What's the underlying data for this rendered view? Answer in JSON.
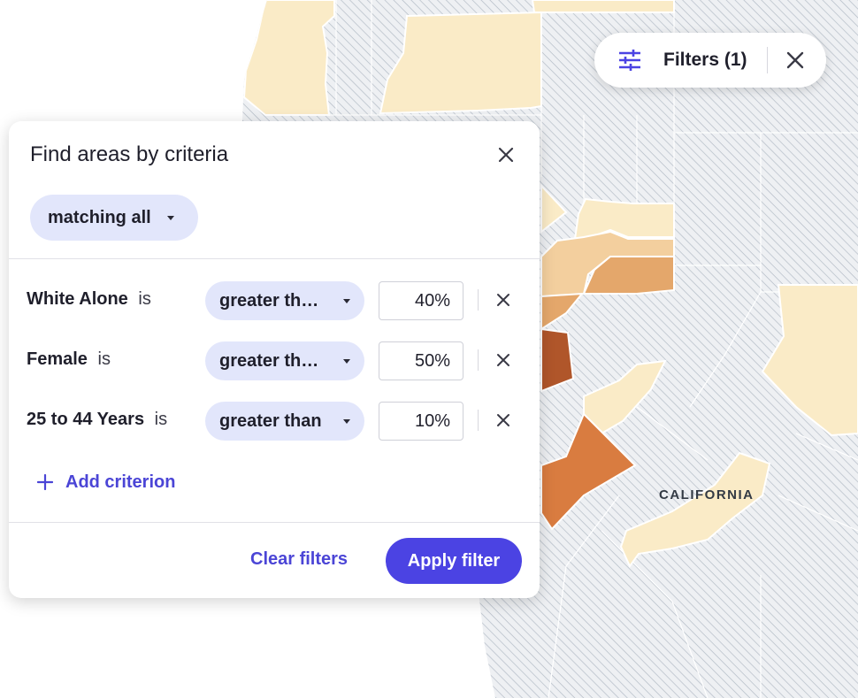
{
  "map": {
    "region_label": "CALIFORNIA",
    "colors": {
      "no_data_hatch": "#b4bcc6",
      "no_data_bg": "#eef0f3",
      "tier_1": "#faebc7",
      "tier_2": "#f3cf9e",
      "tier_3": "#e4a76b",
      "tier_4": "#d97c40",
      "tier_5": "#b0562a",
      "county_border": "#ffffff"
    }
  },
  "filters_pill": {
    "icon": "tune-sliders-icon",
    "label": "Filters (1)",
    "close_icon": "close-icon"
  },
  "panel": {
    "title": "Find areas by criteria",
    "close_icon": "close-icon",
    "match_mode": "matching all",
    "criteria": [
      {
        "field": "White Alone",
        "is_text": "is",
        "operator": "greater th…",
        "value": "40%"
      },
      {
        "field": "Female",
        "is_text": "is",
        "operator": "greater th…",
        "value": "50%"
      },
      {
        "field": "25 to 44 Years",
        "is_text": "is",
        "operator": "greater than",
        "value": "10%"
      }
    ],
    "add_criterion": "Add criterion",
    "clear_filters": "Clear filters",
    "apply_filter": "Apply filter"
  },
  "accent": "#4b43e3"
}
